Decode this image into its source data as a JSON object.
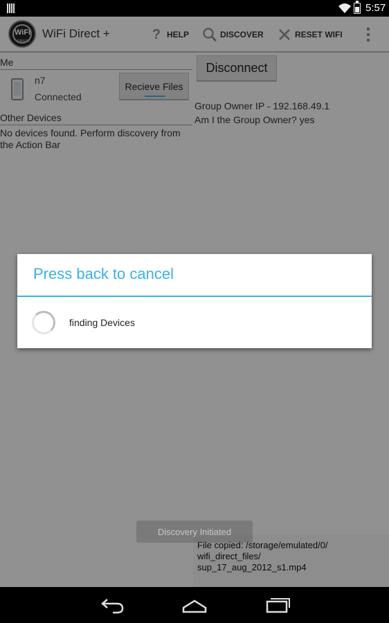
{
  "status_bar": {
    "time": "5:57",
    "icons": [
      "notification-icon",
      "wifi-icon",
      "battery-icon"
    ]
  },
  "action_bar": {
    "title": "WiFi Direct +",
    "logo_text": "WiFi",
    "logo_subtext": "DIRECT",
    "items": {
      "help": "HELP",
      "discover": "DISCOVER",
      "reset_wifi": "RESET WIFI"
    }
  },
  "left_panel": {
    "me_label": "Me",
    "device_name": "n7",
    "device_status": "Connected",
    "receive_button": "Recieve Files",
    "other_devices_label": "Other Devices",
    "no_devices_text": "No devices found. Perform discovery from the Action Bar"
  },
  "right_panel": {
    "disconnect_button": "Disconnect",
    "group_owner_ip": "Group Owner IP - 192.168.49.1",
    "is_group_owner": "Am I the Group Owner? yes"
  },
  "toast": "Discovery Initiated",
  "file_status": "File copied: /storage/emulated/0/\nwifi_direct_files/\nsup_17_aug_2012_s1.mp4",
  "dialog": {
    "title": "Press back to cancel",
    "message": "finding Devices"
  },
  "colors": {
    "accent": "#33b5e5",
    "background": "#f2f2f2",
    "status_bar": "#000000"
  }
}
